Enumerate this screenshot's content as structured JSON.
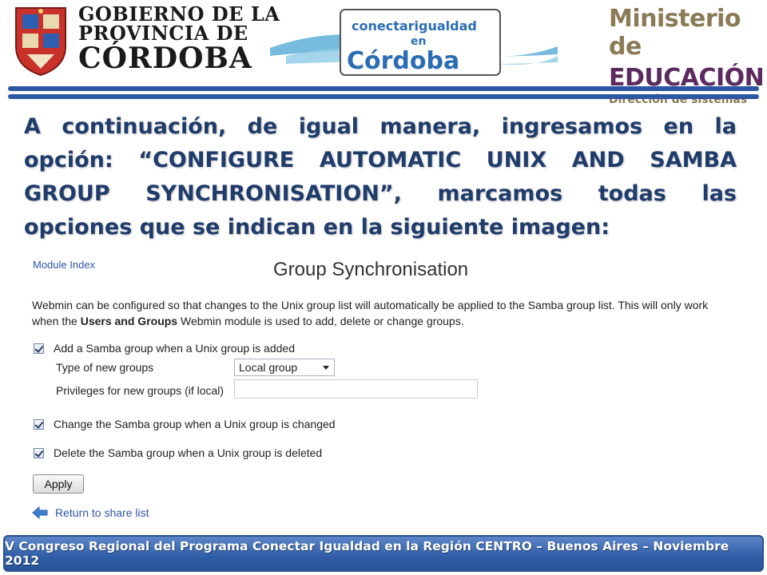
{
  "header": {
    "gov_line1": "GOBIERNO DE LA",
    "gov_line2": "PROVINCIA DE",
    "gov_line3": "CÓRDOBA",
    "conectar_line1": "conectarigualdad",
    "conectar_line2": "en",
    "conectar_line3": "Córdoba",
    "ministerio_line1": "Ministerio de",
    "ministerio_line2": "EDUCACIÓN",
    "ministerio_line3": "Dirección de sistemas",
    "accent_color": "#2b57a3"
  },
  "intro": {
    "text": "A continuación, de igual manera, ingresamos en la opción: “CONFIGURE AUTOMATIC UNIX AND SAMBA GROUP SYNCHRONISATION”, marcamos todas las opciones que se indican en la siguiente imagen:"
  },
  "webmin": {
    "module_index": "Module Index",
    "title": "Group Synchronisation",
    "desc_before": "Webmin can be configured so that changes to the Unix group list will automatically be applied to the Samba group list. This will only work when the ",
    "desc_bold": "Users and Groups",
    "desc_after": " Webmin module is used to add, delete or change groups.",
    "add_group_label": "Add a Samba group when a Unix group is added",
    "type_label": "Type of new groups",
    "type_value": "Local group",
    "privileges_label": "Privileges for new groups (if local)",
    "privileges_value": "",
    "change_group_label": "Change the Samba group when a Unix group is changed",
    "delete_group_label": "Delete the Samba group when a Unix group is deleted",
    "apply_label": "Apply",
    "return_label": "Return to share list",
    "link_color": "#2d55a8"
  },
  "footer": {
    "text": "V Congreso Regional del Programa Conectar Igualdad en la Región CENTRO – Buenos Aires – Noviembre 2012"
  }
}
